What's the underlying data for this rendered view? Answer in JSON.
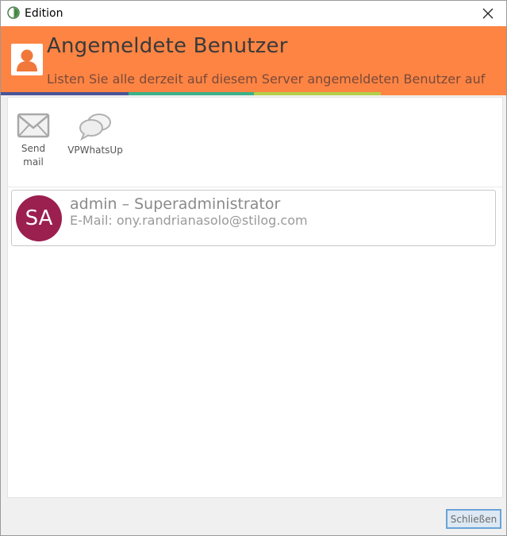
{
  "window": {
    "title": "Edition"
  },
  "header": {
    "title": "Angemeldete Benutzer",
    "subtitle": "Listen Sie alle derzeit auf diesem Server angemeldeten Benutzer auf",
    "band_color": "#fd8443",
    "stripe_colors": [
      "#4a5597",
      "#3bb089",
      "#b2cf4a",
      "#fd8443"
    ]
  },
  "toolbar": {
    "buttons": [
      {
        "label": "Send\nmail",
        "icon": "envelope-icon"
      },
      {
        "label": "VPWhatsUp",
        "icon": "chat-bubbles-icon"
      }
    ]
  },
  "users": [
    {
      "initials": "SA",
      "name": "admin – Superadministrator",
      "email": "E-Mail: ony.randrianasolo@stilog.com",
      "avatar_color": "#9b1f4f"
    }
  ],
  "footer": {
    "close_label": "Schließen"
  }
}
